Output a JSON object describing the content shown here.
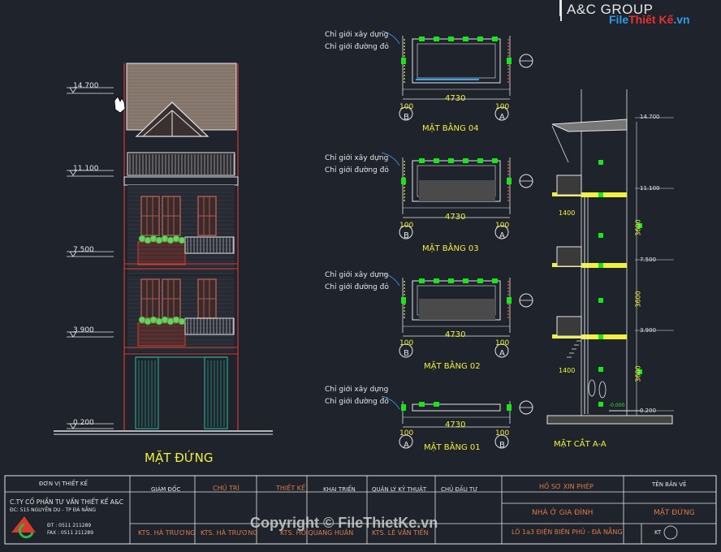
{
  "brand": {
    "title": "A&C GROUP"
  },
  "logo": {
    "part1": "File",
    "part2": "Thiết Kế",
    "part3": ".vn"
  },
  "elevation": {
    "title": "MẶT ĐỨNG",
    "levels": [
      "14.700",
      "11.100",
      "7.500",
      "3.900",
      "0.200"
    ]
  },
  "plans": {
    "boundary_label_1": "Chỉ giới xây dựng",
    "boundary_label_2": "Chỉ giới đường đỏ",
    "width_dim": "4730",
    "side_dim": "100",
    "axis_left_04": "B",
    "axis_right_04": "A",
    "axis_left_01": "A",
    "axis_right_01": "B",
    "titles": [
      "MẶT BẰNG 04",
      "MẶT BẰNG 03",
      "MẶT BẰNG 02",
      "MẶT BẰNG 01"
    ]
  },
  "section": {
    "title": "MẶT CẮT A-A",
    "levels": [
      "14.700",
      "11.100",
      "7.500",
      "3.900",
      "0.200"
    ],
    "dims": [
      "3600",
      "3600",
      "3600"
    ],
    "sub_dims": [
      "1400",
      "1400",
      "1400"
    ],
    "ground": "-0.000"
  },
  "titleblock": {
    "col_don_vi": "ĐƠN VỊ THIẾT KẾ",
    "company": "C.TY CỔ PHẦN TƯ VẤN THIẾT KẾ A&C",
    "address": "ĐC: 515 NGUYỄN DU - TP ĐÀ NẴNG",
    "phone": "ĐT : 0511 211289",
    "fax": "FAX : 0511 211289",
    "giam_doc": "GIÁM ĐỐC",
    "chu_tri": "CHỦ TRÌ",
    "thiet_ke": "THIẾT KẾ",
    "khai_trien": "KHAI TRIỂN",
    "quan_ly": "QUẢN LÝ KỸ THUẬT",
    "chu_dau_tu": "CHỦ ĐẦU TƯ",
    "ho_so": "HỒ SƠ XIN PHÉP",
    "ten_ban_ve": "TÊN BẢN VẼ",
    "project": "NHÀ Ở GIA ĐÌNH",
    "location": "LÔ 1a3 ĐIỆN BIÊN PHỦ - ĐÀ NẴNG",
    "drawing_name": "MẶT ĐỨNG",
    "sheet_code": "KT",
    "name1": "KTS. HÀ TRƯƠNG",
    "name2": "KTS. HÀ TRƯƠNG",
    "name3": "KTS. HỒ QUANG HUÂN",
    "name4": "KTS. LÊ VĂN TIẾN"
  },
  "watermark": "Copyright © FileThietKe.vn",
  "colors": {
    "background": "#1e232c",
    "line_white": "#e6e6e6",
    "line_yellow": "#f2f23a",
    "green_marker": "#19e619",
    "red_wall": "#d93a2c",
    "roof_brown": "#8a7a70",
    "window_red": "#a85a52",
    "door_green": "#2a8a7a",
    "plant_green": "#6ad060"
  }
}
